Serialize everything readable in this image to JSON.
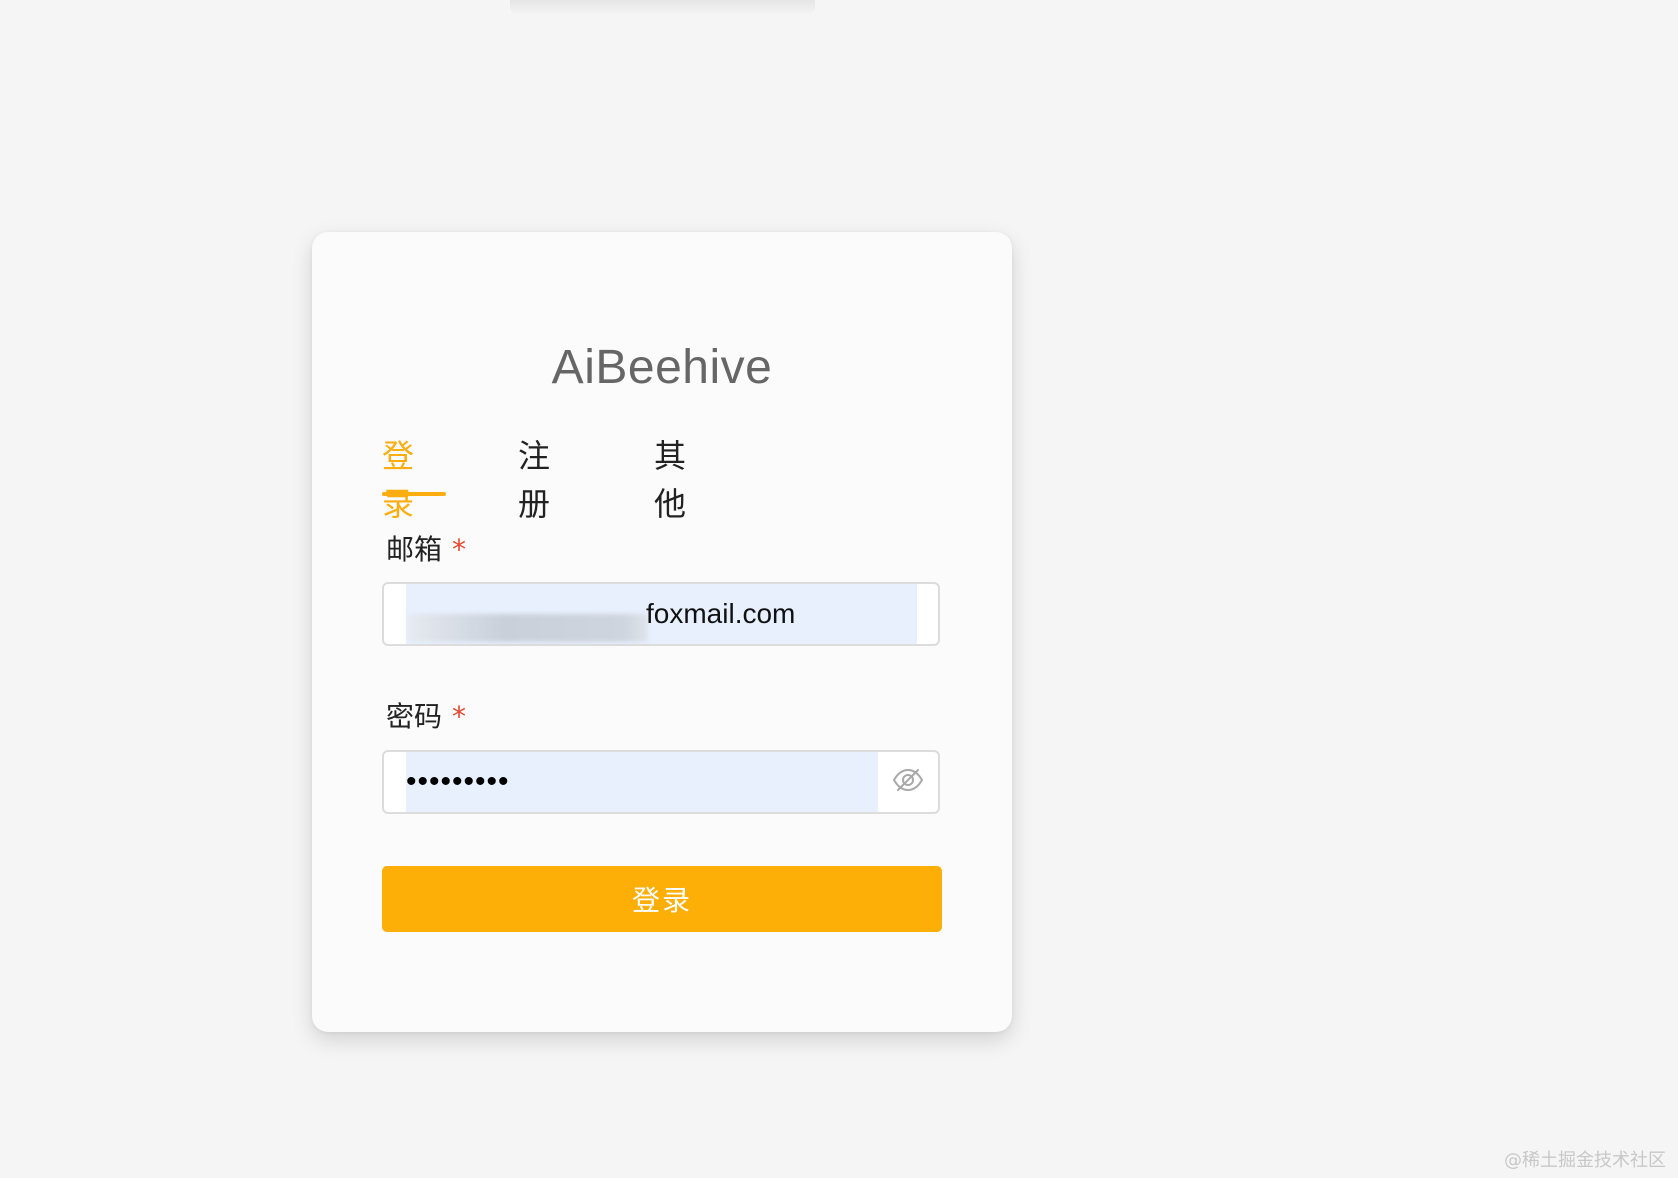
{
  "app": {
    "title": "AiBeehive"
  },
  "tabs": [
    {
      "label": "登录",
      "active": true
    },
    {
      "label": "注册",
      "active": false
    },
    {
      "label": "其他",
      "active": false
    }
  ],
  "form": {
    "email": {
      "label": "邮箱",
      "required_mark": "*",
      "value": "foxmail.com"
    },
    "password": {
      "label": "密码",
      "required_mark": "*",
      "value": "•••••••••",
      "toggle_icon": "eye-off-icon"
    },
    "submit_label": "登录"
  },
  "watermark": "@稀土掘金技术社区",
  "colors": {
    "accent": "#fcad10",
    "required": "#e4482f",
    "autofill": "#e8f0fe"
  }
}
